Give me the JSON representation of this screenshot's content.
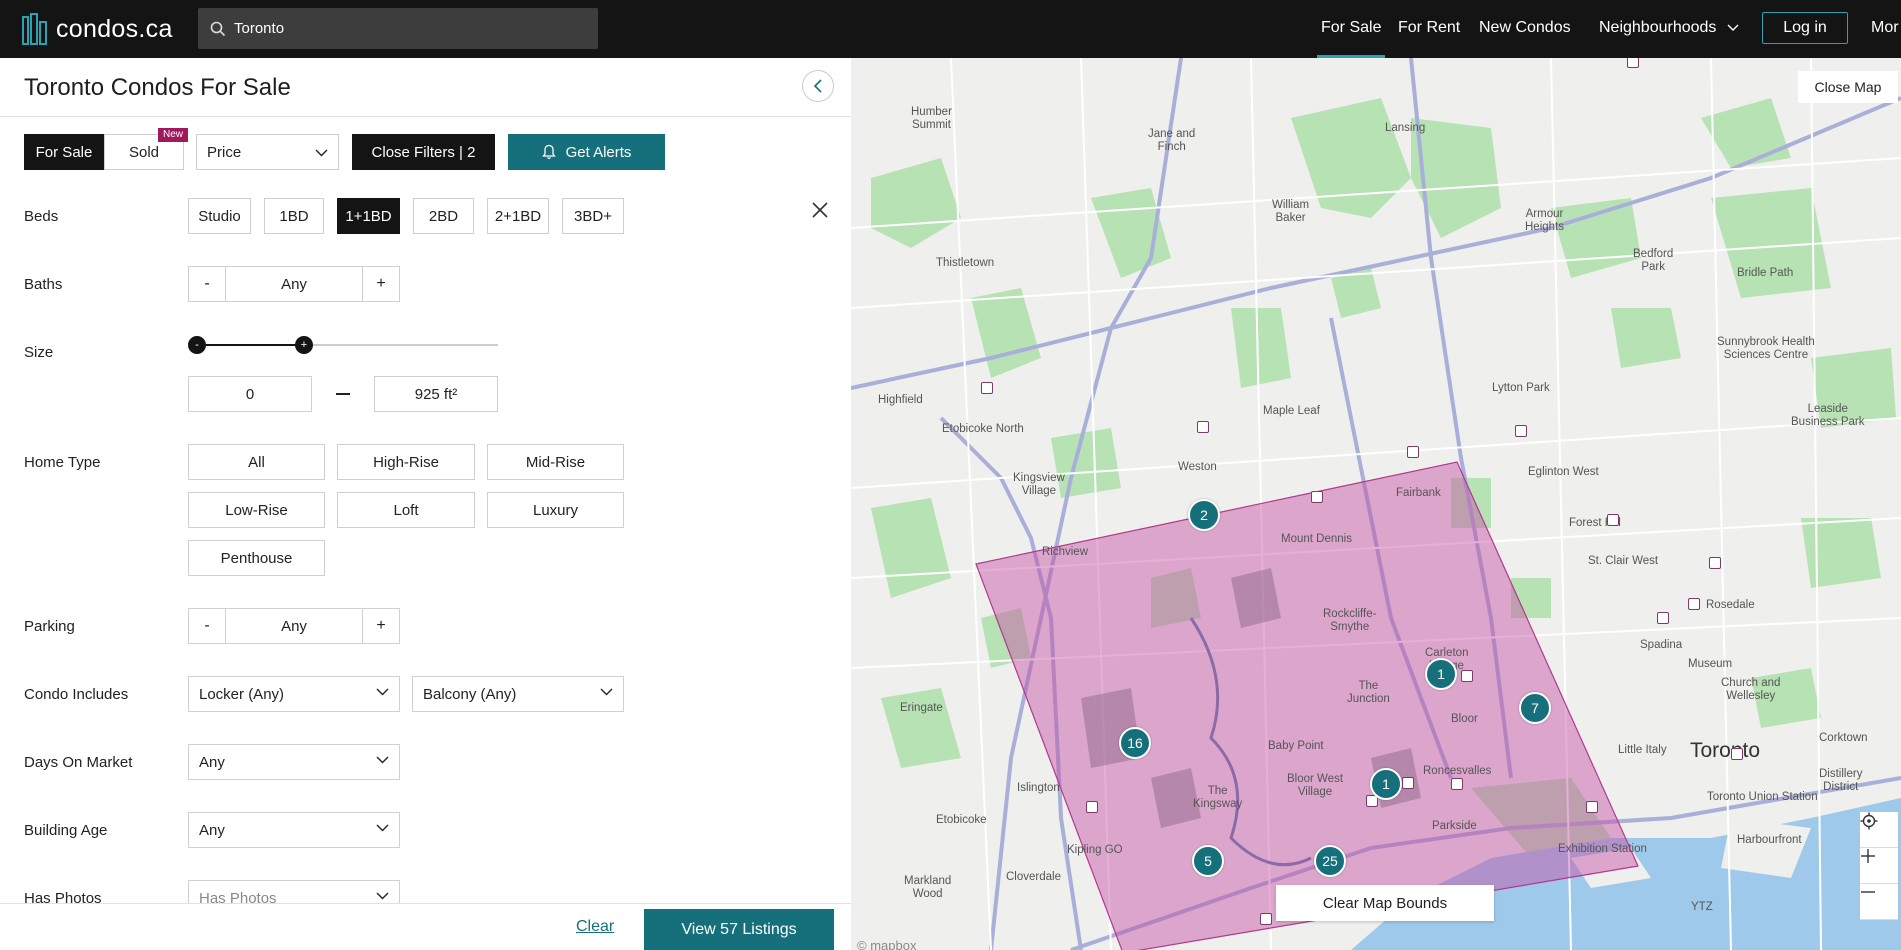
{
  "header": {
    "logo_text": "condos.ca",
    "search_value": "Toronto",
    "nav": [
      "For Sale",
      "For Rent",
      "New Condos",
      "Neighbourhoods",
      "Mor"
    ],
    "login_label": "Log in",
    "accent_color": "#16707c"
  },
  "panel": {
    "title": "Toronto Condos For Sale",
    "toolbar": {
      "for_sale": "For Sale",
      "sold": "Sold",
      "new_badge": "New",
      "price": "Price",
      "close_filters": "Close Filters | 2",
      "get_alerts": "Get Alerts"
    },
    "beds": {
      "label": "Beds",
      "options": [
        "Studio",
        "1BD",
        "1+1BD",
        "2BD",
        "2+1BD",
        "3BD+"
      ],
      "selected": "1+1BD"
    },
    "baths": {
      "label": "Baths",
      "value": "Any",
      "minus": "-",
      "plus": "+"
    },
    "size": {
      "label": "Size",
      "min": "0",
      "max": "925 ft²",
      "knob_min": "-",
      "knob_max": "+"
    },
    "home_type": {
      "label": "Home Type",
      "options": [
        "All",
        "High-Rise",
        "Mid-Rise",
        "Low-Rise",
        "Loft",
        "Luxury",
        "Penthouse"
      ]
    },
    "parking": {
      "label": "Parking",
      "value": "Any",
      "minus": "-",
      "plus": "+"
    },
    "condo_includes": {
      "label": "Condo Includes",
      "locker": "Locker (Any)",
      "balcony": "Balcony (Any)"
    },
    "days_on_market": {
      "label": "Days On Market",
      "value": "Any"
    },
    "building_age": {
      "label": "Building Age",
      "value": "Any"
    },
    "has_photos": {
      "label": "Has Photos",
      "value": "Has Photos"
    },
    "footer": {
      "clear": "Clear",
      "view": "View 57 Listings"
    }
  },
  "map": {
    "close_map": "Close Map",
    "clear_bounds": "Clear Map Bounds",
    "attribution": "© mapbox",
    "clusters": [
      "2",
      "1",
      "7",
      "16",
      "1",
      "5",
      "25"
    ],
    "labels": {
      "humber_summit": "Humber\nSummit",
      "jane_finch": "Jane and\nFinch",
      "lansing": "Lansing",
      "william_baker": "William\nBaker",
      "armour_heights": "Armour\nHeights",
      "bedford_park": "Bedford\nPark",
      "bridle_path": "Bridle Path",
      "thistletown": "Thistletown",
      "sunnybrook": "Sunnybrook Health\nSciences Centre",
      "highfield": "Highfield",
      "etobicoke_north": "Etobicoke North",
      "maple_leaf": "Maple Leaf",
      "lytton_park": "Lytton Park",
      "leaside": "Leaside\nBusiness Park",
      "weston": "Weston",
      "kingsview": "Kingsview\nVillage",
      "fairbank": "Fairbank",
      "eglinton_west": "Eglinton West",
      "forest_hill": "Forest Hill",
      "richview": "Richview",
      "mount_dennis": "Mount Dennis",
      "st_clair_west": "St. Clair West",
      "rockcliffe": "Rockcliffe-\nSmythe",
      "rosedale": "Rosedale",
      "carleton": "Carleton\nVillage",
      "junction": "The\nJunction",
      "spadina": "Spadina",
      "museum": "Museum",
      "church_wellesley": "Church and\nWellesley",
      "eringate": "Eringate",
      "bloor": "Bloor",
      "baby_point": "Baby Point",
      "little_italy": "Little Italy",
      "toronto": "Toronto",
      "corktown": "Corktown",
      "distillery": "Distillery\nDistrict",
      "islington": "Islington",
      "kingsway": "The\nKingsway",
      "bloor_west": "Bloor West\nVillage",
      "roncesvalles": "Roncesvalles",
      "union_station": "Toronto Union Station",
      "etobicoke": "Etobicoke",
      "kipling_go": "Kipling GO",
      "parkside": "Parkside",
      "exhibition": "Exhibition Station",
      "harbourfront": "Harbourfront",
      "cloverdale": "Cloverdale",
      "markland": "Markland\nWood",
      "ytz": "YTZ"
    }
  }
}
